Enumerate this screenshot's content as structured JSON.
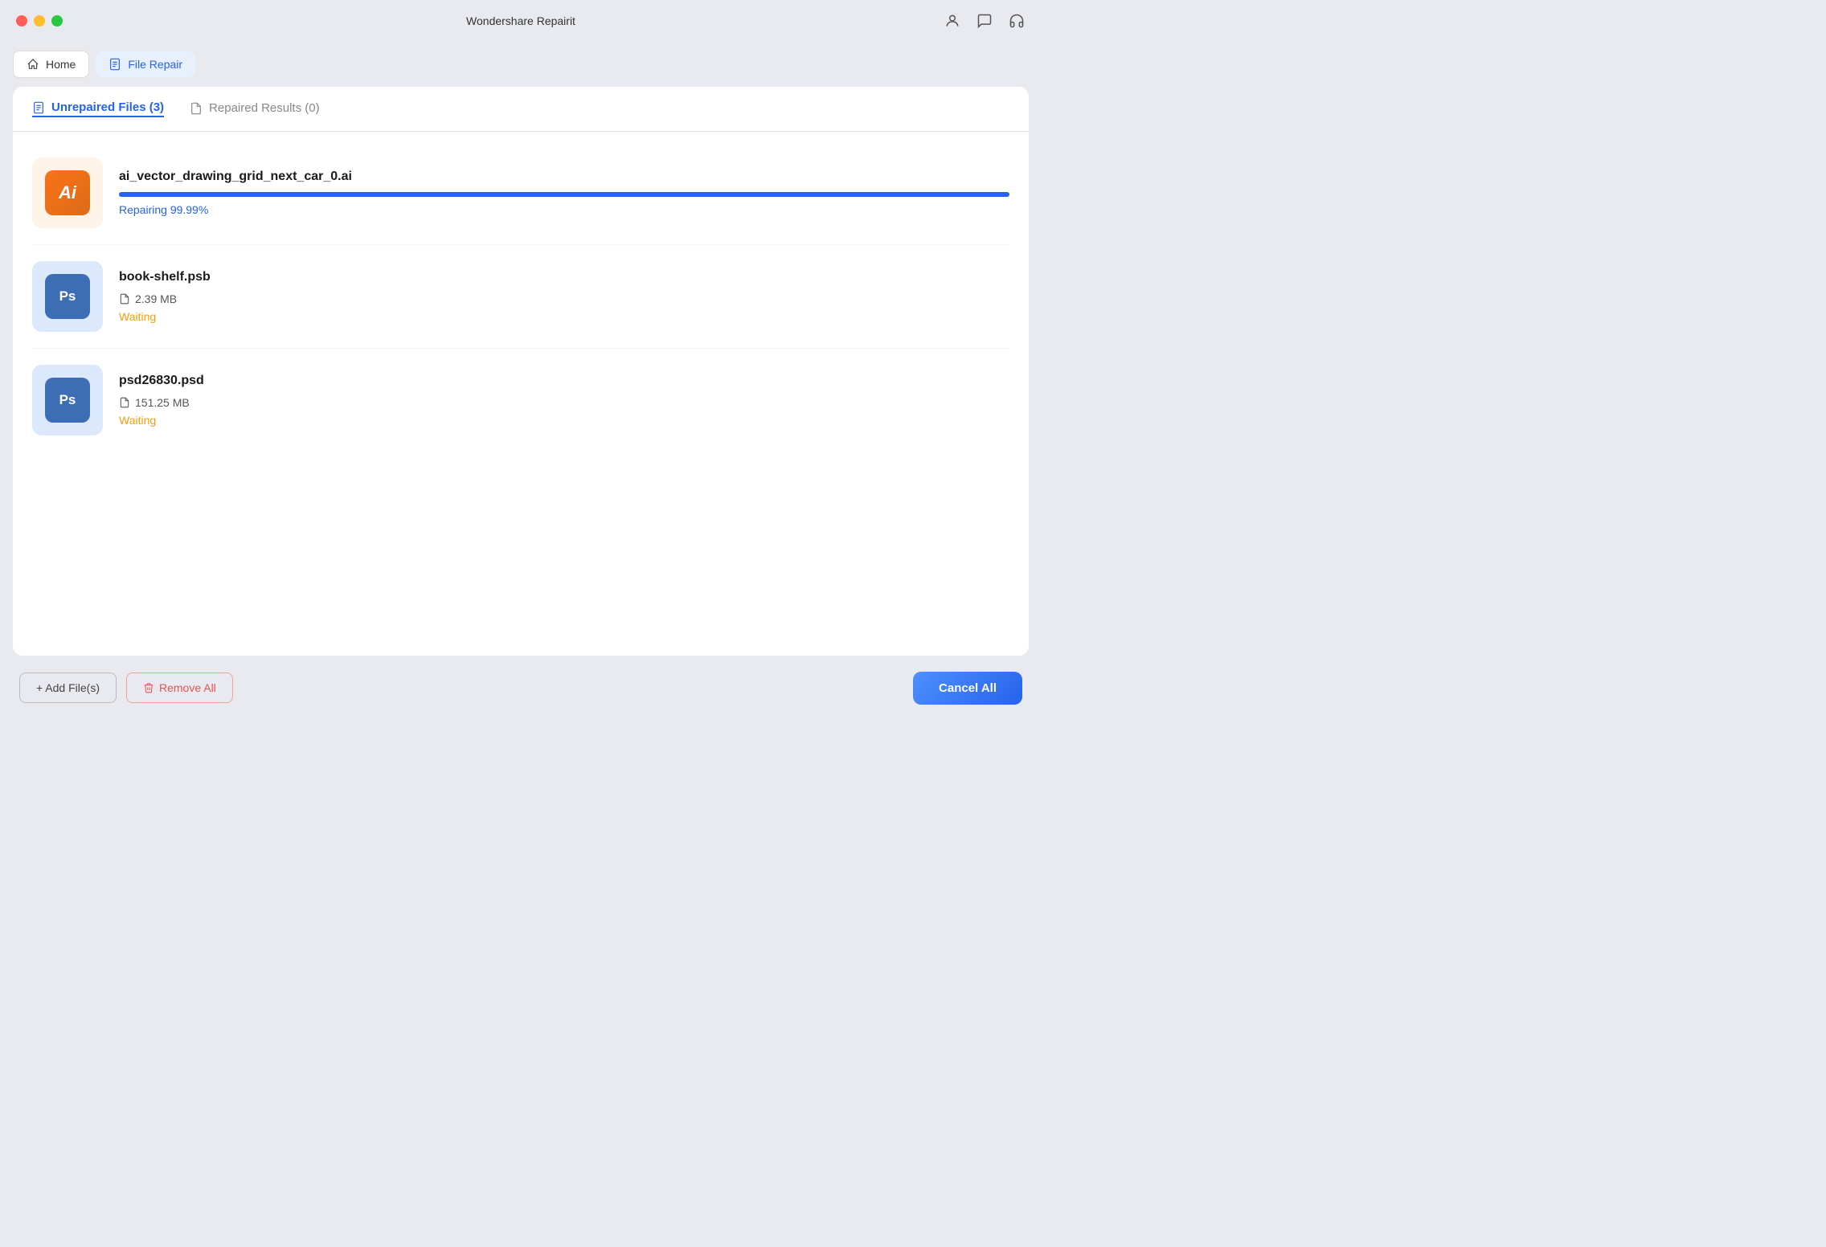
{
  "titleBar": {
    "title": "Wondershare Repairit"
  },
  "navBar": {
    "home": "Home",
    "fileRepair": "File Repair"
  },
  "tabs": {
    "unrepaired": "Unrepaired Files (3)",
    "repaired": "Repaired Results (0)"
  },
  "files": [
    {
      "id": "file-1",
      "name": "ai_vector_drawing_grid_next_car_0.ai",
      "iconType": "ai",
      "iconLabel": "Ai",
      "bgType": "ai-bg",
      "status": "repairing",
      "statusText": "Repairing 99.99%",
      "progress": 99.99,
      "size": null
    },
    {
      "id": "file-2",
      "name": "book-shelf.psb",
      "iconType": "ps",
      "iconLabel": "Ps",
      "bgType": "ps-bg",
      "status": "waiting",
      "statusText": "Waiting",
      "progress": 0,
      "size": "2.39 MB"
    },
    {
      "id": "file-3",
      "name": "psd26830.psd",
      "iconType": "ps",
      "iconLabel": "Ps",
      "bgType": "ps-bg",
      "status": "waiting",
      "statusText": "Waiting",
      "progress": 0,
      "size": "151.25 MB"
    }
  ],
  "bottomBar": {
    "addFiles": "+ Add File(s)",
    "removeAll": "Remove All",
    "cancelAll": "Cancel All"
  }
}
